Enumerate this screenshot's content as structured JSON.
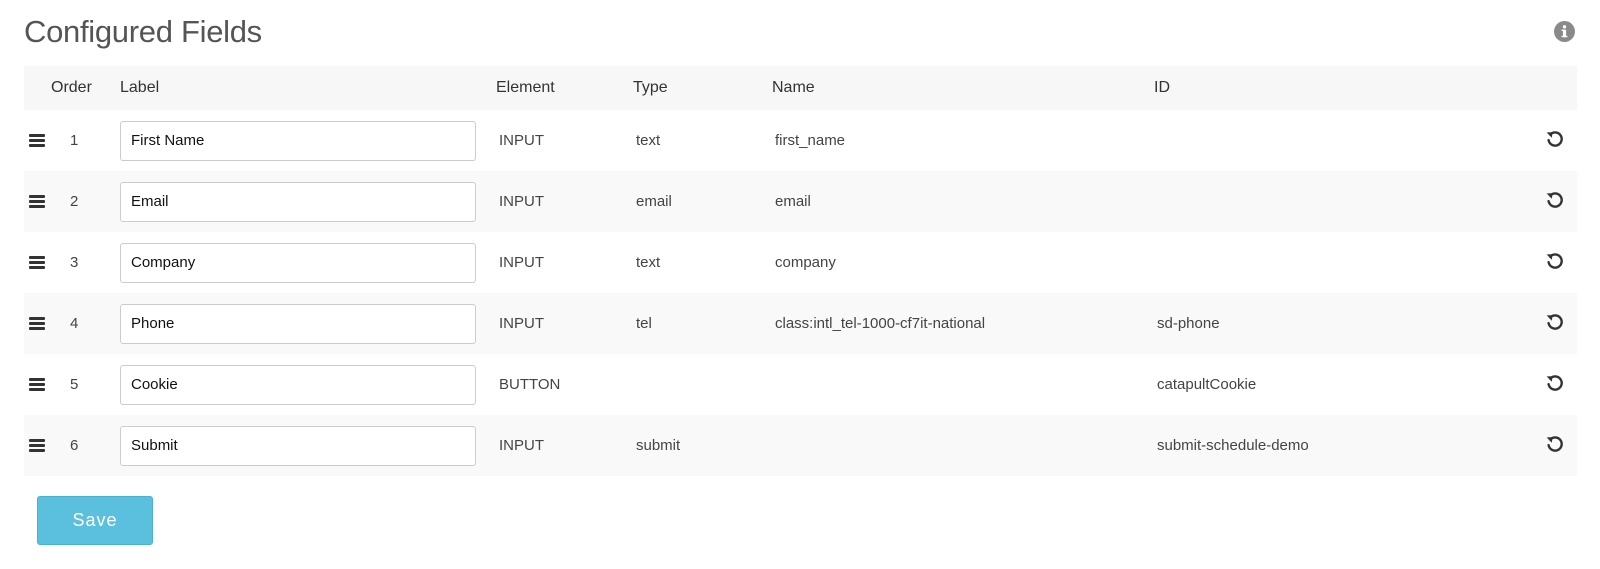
{
  "header": {
    "title": "Configured Fields",
    "info_icon": "info-circle-icon"
  },
  "table": {
    "columns": {
      "order": "Order",
      "label": "Label",
      "element": "Element",
      "type": "Type",
      "name": "Name",
      "id": "ID"
    },
    "rows": [
      {
        "order": "1",
        "label": "First Name",
        "element": "INPUT",
        "type": "text",
        "name": "first_name",
        "id": ""
      },
      {
        "order": "2",
        "label": "Email",
        "element": "INPUT",
        "type": "email",
        "name": "email",
        "id": ""
      },
      {
        "order": "3",
        "label": "Company",
        "element": "INPUT",
        "type": "text",
        "name": "company",
        "id": ""
      },
      {
        "order": "4",
        "label": "Phone",
        "element": "INPUT",
        "type": "tel",
        "name": "class:intl_tel-1000-cf7it-national",
        "id": "sd-phone"
      },
      {
        "order": "5",
        "label": "Cookie",
        "element": "BUTTON",
        "type": "",
        "name": "",
        "id": "catapultCookie"
      },
      {
        "order": "6",
        "label": "Submit",
        "element": "INPUT",
        "type": "submit",
        "name": "",
        "id": "submit-schedule-demo"
      }
    ],
    "row_icons": {
      "handle": "drag-handle-icon",
      "action": "reset-icon"
    }
  },
  "footer": {
    "save_label": "Save"
  },
  "colors": {
    "save_button": "#5bc0de",
    "header_bg": "#f7f7f7",
    "stripe_bg": "#f9f9f9"
  }
}
